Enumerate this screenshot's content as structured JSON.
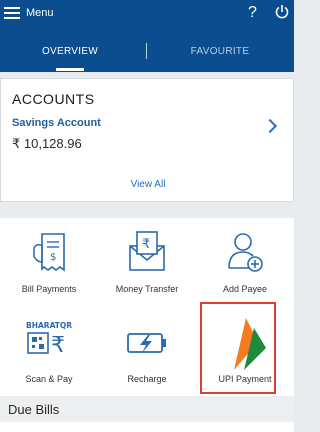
{
  "header": {
    "menu_label": "Menu",
    "help_icon": "question-mark-icon",
    "power_icon": "power-icon",
    "background_color": "#0b4d8f"
  },
  "tabs": [
    {
      "label": "OVERVIEW",
      "active": true
    },
    {
      "label": "FAVOURITE",
      "active": false
    }
  ],
  "accounts": {
    "title": "ACCOUNTS",
    "items": [
      {
        "name": "Savings Account",
        "balance": "₹ 10,128.96"
      }
    ],
    "view_all_label": "View All"
  },
  "services": [
    {
      "label": "Bill Payments",
      "icon": "bill-receipt-icon"
    },
    {
      "label": "Money Transfer",
      "icon": "envelope-rupee-icon"
    },
    {
      "label": "Add Payee",
      "icon": "person-add-icon"
    },
    {
      "label": "Scan & Pay",
      "icon": "bharatqr-icon",
      "icon_text": "BHARATQR"
    },
    {
      "label": "Recharge",
      "icon": "battery-charge-icon"
    },
    {
      "label": "UPI Payment",
      "icon": "upi-logo-icon",
      "highlighted": true
    }
  ],
  "due_bills": {
    "title": "Due Bills"
  },
  "colors": {
    "accent_blue": "#1f5f9a",
    "link_blue": "#1f6fbf",
    "highlight_red": "#e03c31",
    "upi_orange": "#f47b20",
    "upi_green": "#1f8a3b"
  }
}
